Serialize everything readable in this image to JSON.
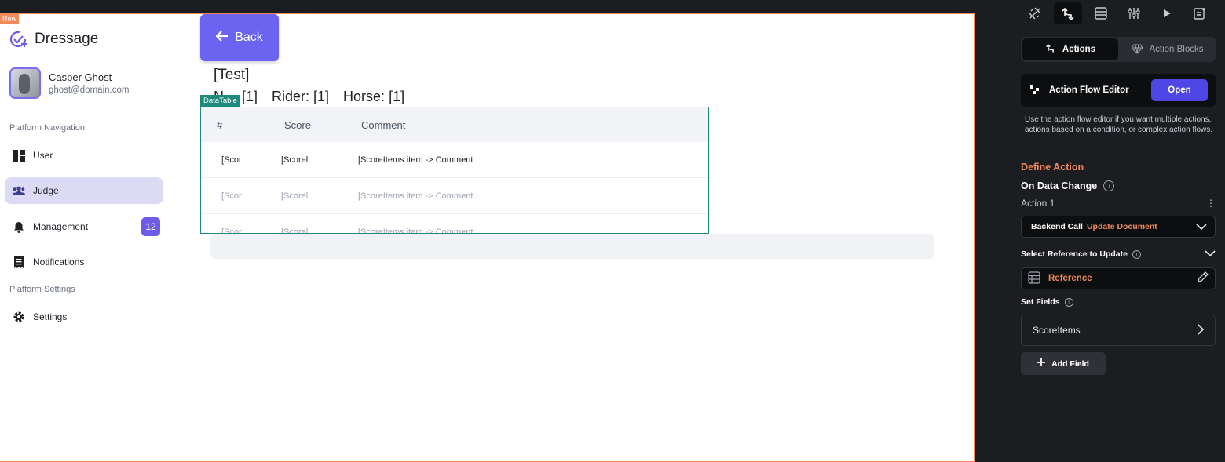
{
  "canvas": {
    "row_tag": "Row",
    "sidebar": {
      "brand": "Dressage",
      "user_name": "Casper Ghost",
      "user_email": "ghost@domain.com",
      "section_navigation": "Platform Navigation",
      "section_settings": "Platform Settings",
      "items": [
        {
          "label": "User",
          "icon": "dashboard-icon"
        },
        {
          "label": "Judge",
          "icon": "group-icon",
          "active": true
        },
        {
          "label": "Management",
          "icon": "bell-icon",
          "badge": "12"
        },
        {
          "label": "Notifications",
          "icon": "receipt-icon"
        },
        {
          "label": "Settings",
          "icon": "gear-icon"
        }
      ]
    },
    "back_label": "Back",
    "test_label": "[Test]",
    "info": {
      "n": "N… [1]",
      "rider": "Rider: [1]",
      "horse": "Horse: [1]"
    },
    "datatable": {
      "tag": "DataTable",
      "columns": [
        "#",
        "Score",
        "Comment"
      ],
      "rows": [
        [
          "[Scor",
          "[Scorel",
          "[ScoreItems item -> Comment"
        ],
        [
          "[Scor",
          "[Scorel",
          "[ScoreItems item -> Comment"
        ],
        [
          "[Scor",
          "[Scorel",
          "[ScoreItems item -> Comment"
        ]
      ]
    }
  },
  "panel": {
    "tabs": {
      "actions": "Actions",
      "action_blocks": "Action Blocks"
    },
    "action_flow_editor": "Action Flow Editor",
    "open_label": "Open",
    "help_text": "Use the action flow editor if you want multiple actions, actions based on a condition, or complex action flows.",
    "define_action": "Define Action",
    "on_data_change": "On Data Change",
    "action1": "Action 1",
    "backend_call": "Backend Call",
    "update_document": "Update Document",
    "select_reference": "Select Reference to Update",
    "reference": "Reference",
    "set_fields": "Set Fields",
    "field_name": "ScoreItems",
    "add_field": "Add Field",
    "colors": {
      "accent": "#f08a5d",
      "primary": "#4f46e5",
      "datatable": "#1e8a7a"
    }
  }
}
